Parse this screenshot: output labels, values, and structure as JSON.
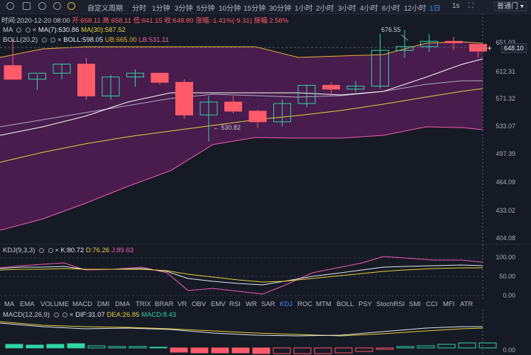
{
  "toolbar": {
    "period_custom": "自定义周期",
    "periods": [
      "分时",
      "1分钟",
      "3分钟",
      "5分钟",
      "10分钟",
      "15分钟",
      "30分钟",
      "1小时",
      "2小时",
      "3小时",
      "4小时",
      "6小时",
      "12小时",
      "1日"
    ],
    "active_period": "1日",
    "right_label": "1s",
    "layout_select": "普通门"
  },
  "ohlc": {
    "time_label": "时间:2020-12-20 08:00",
    "open": "开:658.11",
    "high": "高:658.11",
    "low": "低:641.15",
    "close": "收:648.80",
    "change": "涨幅:-1.41%(-9.31)",
    "amplitude": "振幅:2.58%"
  },
  "main_indicators": {
    "ma_label": "MA",
    "ma7": "MA(7):630.86",
    "ma30": "MA(30):587.52",
    "boll_label": "BOLL(20,2)",
    "boll_mid": "BOLL:598.05",
    "boll_ub": "UB:665.00",
    "boll_lb": "LB:531.11"
  },
  "price_axis": [
    "651.03",
    "612.31",
    "571.32",
    "533.07",
    "497.39",
    "464.09",
    "433.02",
    "404.08"
  ],
  "current_price": "648.10",
  "high_marker": "676.55",
  "low_marker": "530.82",
  "kdj": {
    "label": "KDJ(9,3,3)",
    "k": "K:80.72",
    "d": "D:76.26",
    "j": "J:89.63",
    "axis": [
      "100.00",
      "50.00",
      "0.00"
    ]
  },
  "tabs": [
    "MA",
    "EMA",
    "VOLUME",
    "MACD",
    "DMI",
    "DMA",
    "TRIX",
    "BRAR",
    "VR",
    "OBV",
    "EMV",
    "RSI",
    "WR",
    "SAR",
    "KDJ",
    "ROC",
    "MTM",
    "BOLL",
    "PSY",
    "StochRSI",
    "SMI",
    "CCI",
    "MFI",
    "ATR"
  ],
  "active_tab": "KDJ",
  "macd": {
    "label": "MACD(12,26,9)",
    "dif": "DIF:31.07",
    "dea": "DEA:26.85",
    "macd": "MACD:8.43",
    "axis": [
      "0.00"
    ]
  },
  "colors": {
    "up": "#2fd6a6",
    "down": "#ff5b6a",
    "boll_fill": "#4b1c4f",
    "ma7": "#ffffff",
    "ma30": "#e4d33c",
    "boll_band": "#ef5fb0",
    "accent": "#3d8bff"
  },
  "candles": [
    {
      "o": 630,
      "h": 664,
      "l": 612,
      "c": 612
    },
    {
      "o": 612,
      "h": 618,
      "l": 598,
      "c": 620
    },
    {
      "o": 620,
      "h": 632,
      "l": 612,
      "c": 632
    },
    {
      "o": 632,
      "h": 640,
      "l": 585,
      "c": 590
    },
    {
      "o": 590,
      "h": 618,
      "l": 585,
      "c": 615
    },
    {
      "o": 615,
      "h": 625,
      "l": 602,
      "c": 620
    },
    {
      "o": 620,
      "h": 620,
      "l": 605,
      "c": 608
    },
    {
      "o": 608,
      "h": 612,
      "l": 560,
      "c": 565
    },
    {
      "o": 565,
      "h": 590,
      "l": 530,
      "c": 582
    },
    {
      "o": 582,
      "h": 590,
      "l": 567,
      "c": 570
    },
    {
      "o": 570,
      "h": 572,
      "l": 548,
      "c": 556
    },
    {
      "o": 556,
      "h": 585,
      "l": 550,
      "c": 580
    },
    {
      "o": 580,
      "h": 605,
      "l": 575,
      "c": 604
    },
    {
      "o": 604,
      "h": 608,
      "l": 590,
      "c": 599
    },
    {
      "o": 599,
      "h": 610,
      "l": 595,
      "c": 603
    },
    {
      "o": 603,
      "h": 672,
      "l": 600,
      "c": 650
    },
    {
      "o": 650,
      "h": 677,
      "l": 640,
      "c": 655
    },
    {
      "o": 655,
      "h": 672,
      "l": 648,
      "c": 662
    },
    {
      "o": 662,
      "h": 668,
      "l": 650,
      "c": 660
    },
    {
      "o": 658,
      "h": 658,
      "l": 641,
      "c": 649
    }
  ]
}
